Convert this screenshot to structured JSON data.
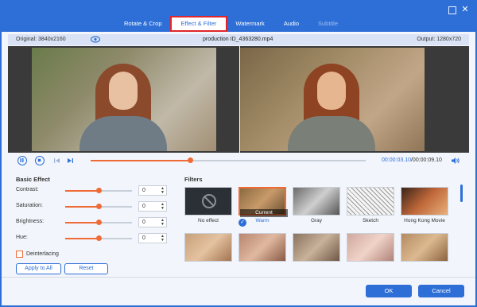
{
  "tabs": [
    {
      "label": "Rotate & Crop"
    },
    {
      "label": "Effect & Filter"
    },
    {
      "label": "Watermark"
    },
    {
      "label": "Audio"
    },
    {
      "label": "Subtitle"
    }
  ],
  "info": {
    "original": "Original: 3840x2160",
    "filename": "production ID_4363280.mp4",
    "output": "Output: 1280x720"
  },
  "player": {
    "current_time": "00:00:03.10",
    "duration": "/00:00:09.10",
    "progress": 0.36
  },
  "basic_effect": {
    "title": "Basic Effect",
    "sliders": [
      {
        "label": "Contrast:",
        "value": "0",
        "level": 0.5
      },
      {
        "label": "Saturation:",
        "value": "0",
        "level": 0.5
      },
      {
        "label": "Brightness:",
        "value": "0",
        "level": 0.5
      },
      {
        "label": "Hue:",
        "value": "0",
        "level": 0.5
      }
    ],
    "deinterlacing": "Deinterlacing",
    "apply_all": "Apply to All",
    "reset": "Reset"
  },
  "filters": {
    "title": "Filters",
    "items": [
      {
        "name": "No effect"
      },
      {
        "name": "Warm",
        "badge": "Current"
      },
      {
        "name": "Gray"
      },
      {
        "name": "Sketch"
      },
      {
        "name": "Hong Kong Movie"
      }
    ]
  },
  "footer": {
    "ok": "OK",
    "cancel": "Cancel"
  },
  "colors": {
    "accent": "#2e6fd7",
    "highlight": "#f06a35"
  }
}
